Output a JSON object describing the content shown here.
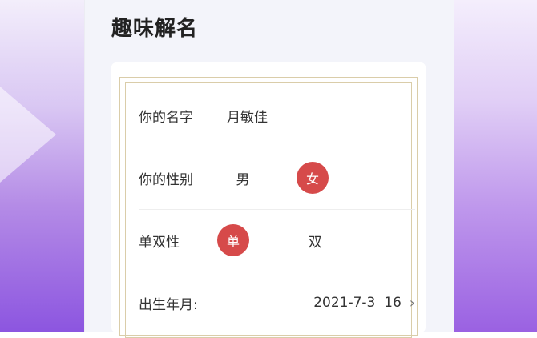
{
  "page": {
    "title": "趣味解名"
  },
  "form": {
    "name_label": "你的名字",
    "name_value": "月敏佳",
    "gender_label": "你的性别",
    "gender_options": [
      "男",
      "女"
    ],
    "gender_selected": "女",
    "parity_label": "单双性",
    "parity_options": [
      "单",
      "双"
    ],
    "parity_selected": "单",
    "birth_label": "出生年月:",
    "birth_value": "2021-7-3  16"
  },
  "colors": {
    "accent": "#d64a4a",
    "frame": "#dacda9",
    "panel_bg": "#f3f4fa"
  }
}
